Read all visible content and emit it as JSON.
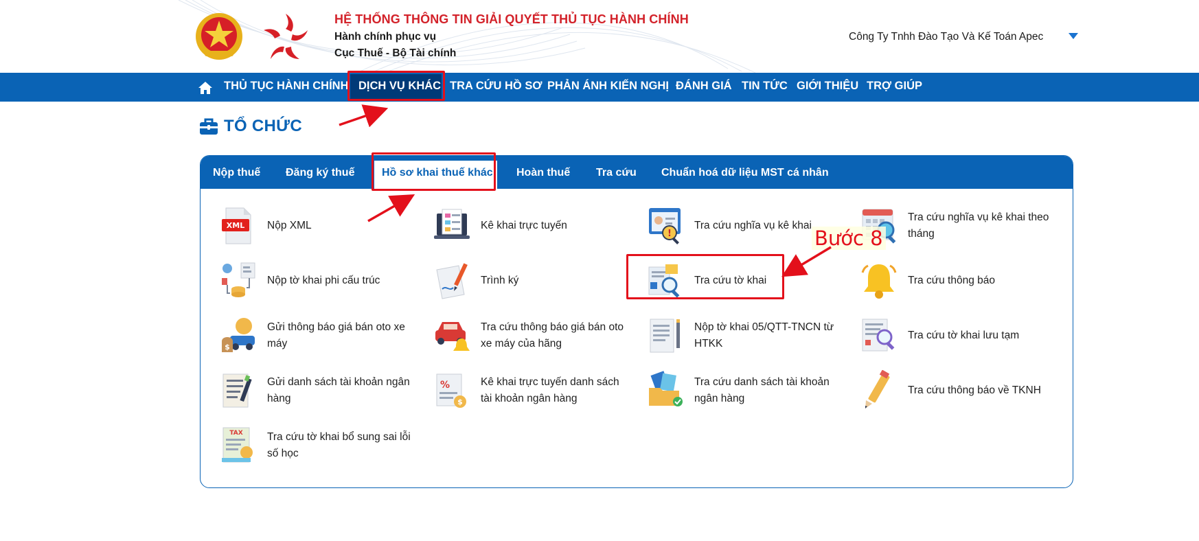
{
  "header": {
    "system_title": "HỆ THỐNG THÔNG TIN GIẢI QUYẾT THỦ TỤC HÀNH CHÍNH",
    "subtitle_1": "Hành chính phục vụ",
    "subtitle_2": "Cục Thuế - Bộ Tài chính",
    "company_name": "Công Ty Tnhh Đào Tạo Và Kế Toán Apec"
  },
  "nav": {
    "items": [
      {
        "label": "THỦ TỤC HÀNH CHÍNH"
      },
      {
        "label": "DỊCH VỤ KHÁC",
        "active": true
      },
      {
        "label": "TRA CỨU HỒ SƠ"
      },
      {
        "label": "PHẢN ÁNH KIẾN NGHỊ"
      },
      {
        "label": "ĐÁNH GIÁ"
      },
      {
        "label": "TIN TỨC"
      },
      {
        "label": "GIỚI THIỆU"
      },
      {
        "label": "TRỢ GIÚP"
      }
    ]
  },
  "page": {
    "title": "TỔ CHỨC"
  },
  "tabs": [
    {
      "label": "Nộp thuế"
    },
    {
      "label": "Đăng ký thuế"
    },
    {
      "label": "Hồ sơ khai thuế khác",
      "active": true
    },
    {
      "label": "Hoàn thuế"
    },
    {
      "label": "Tra cứu"
    },
    {
      "label": "Chuẩn hoá dữ liệu MST cá nhân"
    }
  ],
  "services": [
    {
      "label": "Nộp XML",
      "icon": "xml-file-icon"
    },
    {
      "label": "Kê khai trực tuyến",
      "icon": "laptop-form-icon"
    },
    {
      "label": "Tra cứu nghĩa vụ kê khai",
      "icon": "profile-search-icon"
    },
    {
      "label": "Tra cứu nghĩa vụ kê khai theo tháng",
      "icon": "calendar-search-icon"
    },
    {
      "label": "Nộp tờ khai phi cấu trúc",
      "icon": "data-flow-icon"
    },
    {
      "label": "Trình ký",
      "icon": "sign-document-icon"
    },
    {
      "label": "Tra cứu tờ khai",
      "icon": "document-search-icon"
    },
    {
      "label": "Tra cứu thông báo",
      "icon": "bell-icon"
    },
    {
      "label": "Gửi thông báo giá bán oto xe máy",
      "icon": "car-price-icon"
    },
    {
      "label": "Tra cứu thông báo giá bán oto xe máy của hãng",
      "icon": "car-bell-icon"
    },
    {
      "label": "Nộp tờ khai 05/QTT-TNCN từ HTKK",
      "icon": "document-pen-icon"
    },
    {
      "label": "Tra cứu tờ khai lưu tạm",
      "icon": "saved-document-search-icon"
    },
    {
      "label": "Gửi danh sách tài khoản ngân hàng",
      "icon": "list-pen-icon"
    },
    {
      "label": "Kê khai trực tuyến danh sách tài khoản ngân hàng",
      "icon": "percent-document-icon"
    },
    {
      "label": "Tra cứu danh sách tài khoản ngân hàng",
      "icon": "folder-check-icon"
    },
    {
      "label": "Tra cứu thông báo về TKNH",
      "icon": "pencil-icon"
    },
    {
      "label": "Tra cứu tờ khai bổ sung sai lỗi số học",
      "icon": "tax-document-icon"
    }
  ],
  "annotation": {
    "step_label": "Bước 8"
  },
  "colors": {
    "brand_blue": "#0a63b5",
    "active_nav": "#003a78",
    "highlight_red": "#e3101b",
    "title_red": "#d3222a"
  }
}
